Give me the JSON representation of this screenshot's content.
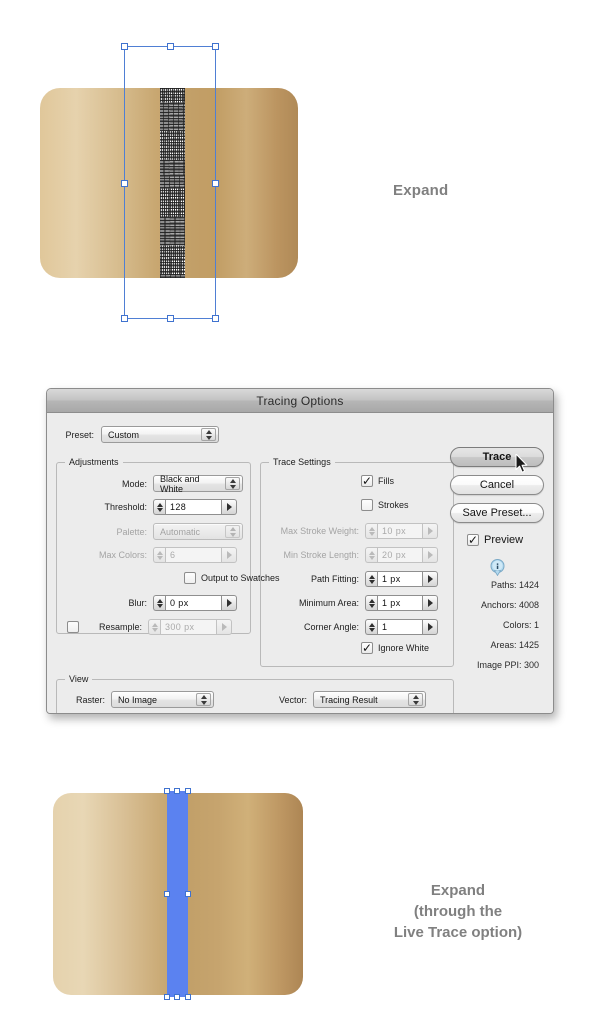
{
  "captions": {
    "top": "Expand",
    "bottom_line1": "Expand",
    "bottom_line2": "(through the",
    "bottom_line3": "Live Trace option)"
  },
  "dialog": {
    "title": "Tracing Options",
    "preset": {
      "label": "Preset:",
      "value": "Custom"
    },
    "adjustments": {
      "title": "Adjustments",
      "mode": {
        "label": "Mode:",
        "value": "Black and White"
      },
      "threshold": {
        "label": "Threshold:",
        "value": "128"
      },
      "palette": {
        "label": "Palette:",
        "value": "Automatic"
      },
      "max_colors": {
        "label": "Max Colors:",
        "value": "6"
      },
      "output_to_swatches": {
        "label": "Output to Swatches",
        "checked": false
      },
      "blur": {
        "label": "Blur:",
        "value": "0 px"
      },
      "resample": {
        "label": "Resample:",
        "value": "300 px",
        "checked": false
      }
    },
    "trace_settings": {
      "title": "Trace Settings",
      "fills": {
        "label": "Fills",
        "checked": true
      },
      "strokes": {
        "label": "Strokes",
        "checked": false
      },
      "max_stroke_weight": {
        "label": "Max Stroke Weight:",
        "value": "10 px"
      },
      "min_stroke_length": {
        "label": "Min Stroke Length:",
        "value": "20 px"
      },
      "path_fitting": {
        "label": "Path Fitting:",
        "value": "1 px"
      },
      "minimum_area": {
        "label": "Minimum Area:",
        "value": "1 px"
      },
      "corner_angle": {
        "label": "Corner Angle:",
        "value": "1"
      },
      "ignore_white": {
        "label": "Ignore White",
        "checked": true
      }
    },
    "view": {
      "title": "View",
      "raster": {
        "label": "Raster:",
        "value": "No Image"
      },
      "vector": {
        "label": "Vector:",
        "value": "Tracing Result"
      }
    },
    "buttons": {
      "trace": "Trace",
      "cancel": "Cancel",
      "save_preset": "Save Preset..."
    },
    "preview": {
      "label": "Preview",
      "checked": true
    },
    "stats": [
      "Paths: 1424",
      "Anchors: 4008",
      "Colors: 1",
      "Areas: 1425",
      "Image PPI: 300"
    ]
  },
  "colors": {
    "selection_blue": "#4f7fd4",
    "strip_blue": "#5b82f0",
    "caption_gray": "#808080",
    "dialog_bg": "#ececec"
  }
}
